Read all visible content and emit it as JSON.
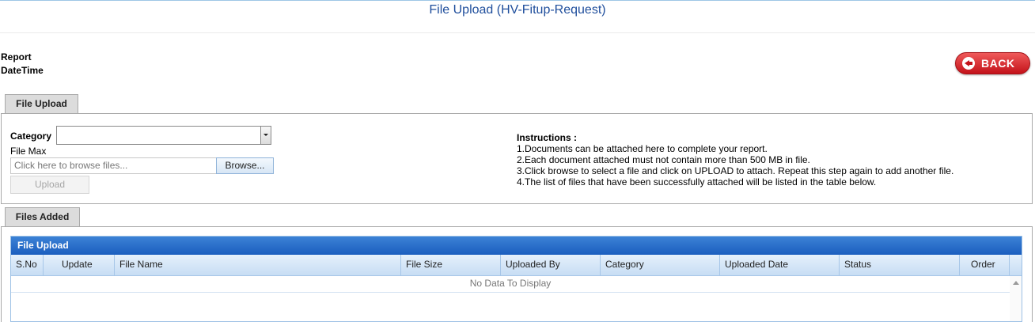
{
  "page": {
    "title": "File Upload (HV-Fitup-Request)",
    "report_label": "Report DateTime",
    "back_label": "BACK"
  },
  "tabs": {
    "upload_tab": "File Upload",
    "added_tab": "Files Added"
  },
  "upload_form": {
    "category_label": "Category",
    "category_value": "",
    "file_max_label": "File Max",
    "file_placeholder": "Click here to browse files...",
    "browse_label": "Browse...",
    "upload_label": "Upload"
  },
  "instructions": {
    "title": "Instructions :",
    "lines": [
      "1.Documents can be attached here to complete your report.",
      "2.Each document attached must not contain more than 500 MB in file.",
      "3.Click browse to select a file and click on UPLOAD to attach. Repeat this step again to add another file.",
      "4.The list of files that have been successfully attached will be listed in the table below."
    ]
  },
  "grid": {
    "title": "File Upload",
    "columns": [
      "S.No",
      "Update",
      "File Name",
      "File Size",
      "Uploaded By",
      "Category",
      "Uploaded Date",
      "Status",
      "Order"
    ],
    "empty_text": "No Data To Display",
    "rows": []
  }
}
